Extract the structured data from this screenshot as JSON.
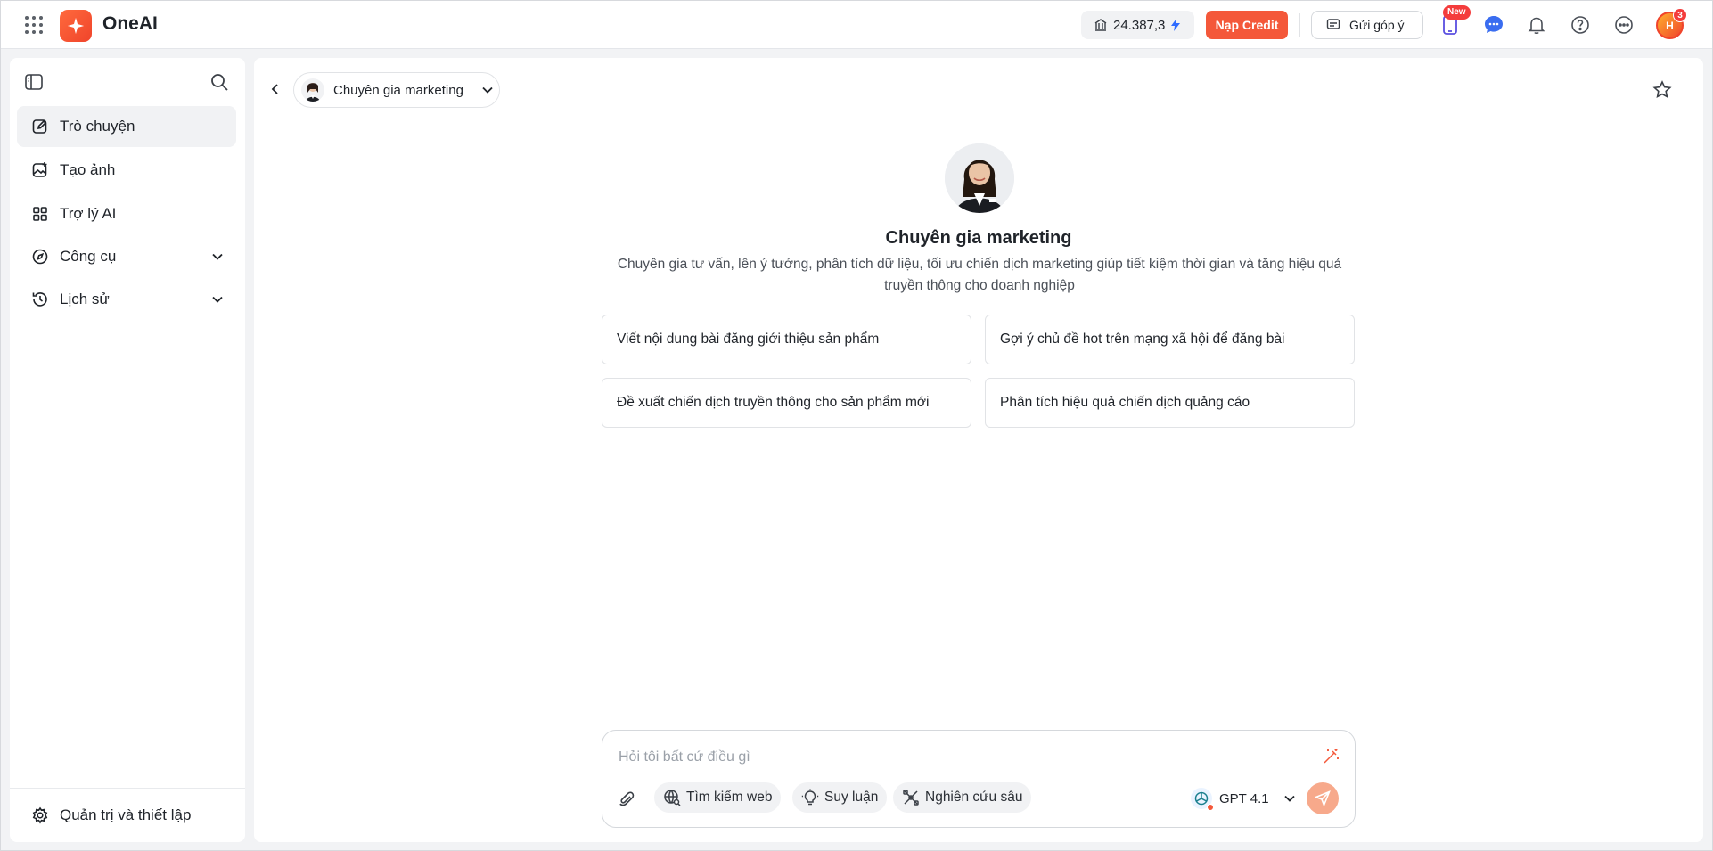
{
  "app": {
    "brand": "OneAI",
    "accent_color": "#f4583a"
  },
  "topbar": {
    "credit_balance": "24.387,3",
    "topup_label": "Nạp Credit",
    "feedback_label": "Gửi góp ý",
    "new_badge": "New",
    "user_initials": "H",
    "notification_count": "3"
  },
  "sidebar": {
    "items": [
      {
        "label": "Trò chuyện",
        "icon": "edit-icon",
        "active": true
      },
      {
        "label": "Tạo ảnh",
        "icon": "image-add-icon"
      },
      {
        "label": "Trợ lý AI",
        "icon": "grid-icon"
      },
      {
        "label": "Công cụ",
        "icon": "compass-icon",
        "expandable": true
      },
      {
        "label": "Lịch sử",
        "icon": "history-icon",
        "expandable": true
      }
    ],
    "settings_label": "Quản trị và thiết lập"
  },
  "main": {
    "persona_name": "Chuyên gia marketing",
    "hero_title": "Chuyên gia marketing",
    "hero_description": "Chuyên gia tư vấn, lên ý tưởng, phân tích dữ liệu, tối ưu chiến dịch marketing giúp tiết kiệm thời gian và tăng hiệu quả truyền thông cho doanh nghiệp",
    "suggestions": [
      "Viết nội dung bài đăng giới thiệu sản phẩm",
      "Gợi ý chủ đề hot trên mạng xã hội để đăng bài",
      "Đề xuất chiến dịch truyền thông cho sản phẩm mới",
      "Phân tích hiệu quả chiến dịch quảng cáo"
    ]
  },
  "composer": {
    "placeholder": "Hỏi tôi bất cứ điều gì",
    "value": "",
    "web_search_label": "Tìm kiếm web",
    "reasoning_label": "Suy luận",
    "deep_research_label": "Nghiên cứu sâu",
    "model": "GPT 4.1"
  }
}
